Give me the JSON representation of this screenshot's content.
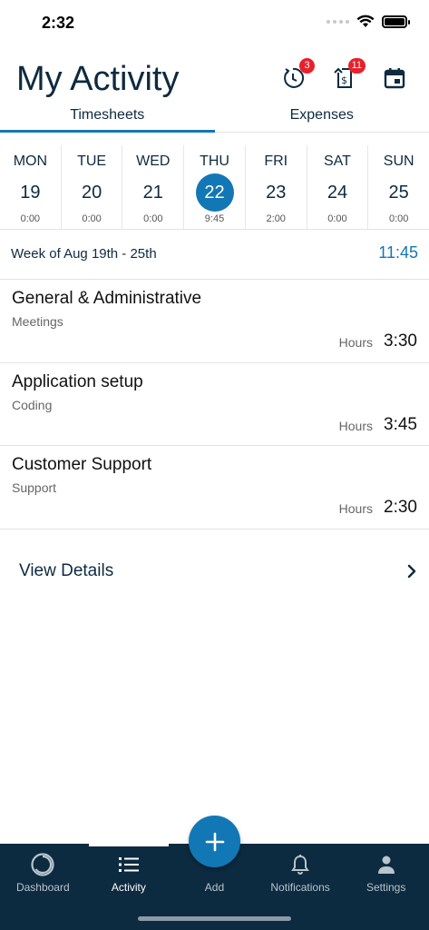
{
  "status_bar": {
    "time": "2:32"
  },
  "header": {
    "title": "My Activity",
    "timesheet_sync_badge": "3",
    "expense_sync_badge": "11"
  },
  "tabs": [
    {
      "label": "Timesheets",
      "active": true
    },
    {
      "label": "Expenses",
      "active": false
    }
  ],
  "week": {
    "days": [
      {
        "name": "MON",
        "num": "19",
        "hours": "0:00"
      },
      {
        "name": "TUE",
        "num": "20",
        "hours": "0:00"
      },
      {
        "name": "WED",
        "num": "21",
        "hours": "0:00"
      },
      {
        "name": "THU",
        "num": "22",
        "hours": "9:45",
        "selected": true
      },
      {
        "name": "FRI",
        "num": "23",
        "hours": "2:00"
      },
      {
        "name": "SAT",
        "num": "24",
        "hours": "0:00"
      },
      {
        "name": "SUN",
        "num": "25",
        "hours": "0:00"
      }
    ],
    "label": "Week of Aug 19th - 25th",
    "total": "11:45"
  },
  "entries": [
    {
      "title": "General & Administrative",
      "subtitle": "Meetings",
      "hours_label": "Hours",
      "hours": "3:30"
    },
    {
      "title": "Application setup",
      "subtitle": "Coding",
      "hours_label": "Hours",
      "hours": "3:45"
    },
    {
      "title": "Customer Support",
      "subtitle": "Support",
      "hours_label": "Hours",
      "hours": "2:30"
    }
  ],
  "view_details": {
    "label": "View Details"
  },
  "nav": [
    {
      "label": "Dashboard",
      "icon": "dashboard-icon"
    },
    {
      "label": "Activity",
      "icon": "list-icon",
      "active": true
    },
    {
      "label": "Add",
      "icon": "plus-icon"
    },
    {
      "label": "Notifications",
      "icon": "bell-icon"
    },
    {
      "label": "Settings",
      "icon": "person-icon"
    }
  ],
  "colors": {
    "accent": "#1277b5",
    "nav_bg": "#0c2a40",
    "title": "#0e2a3f",
    "badge": "#e8202a"
  }
}
